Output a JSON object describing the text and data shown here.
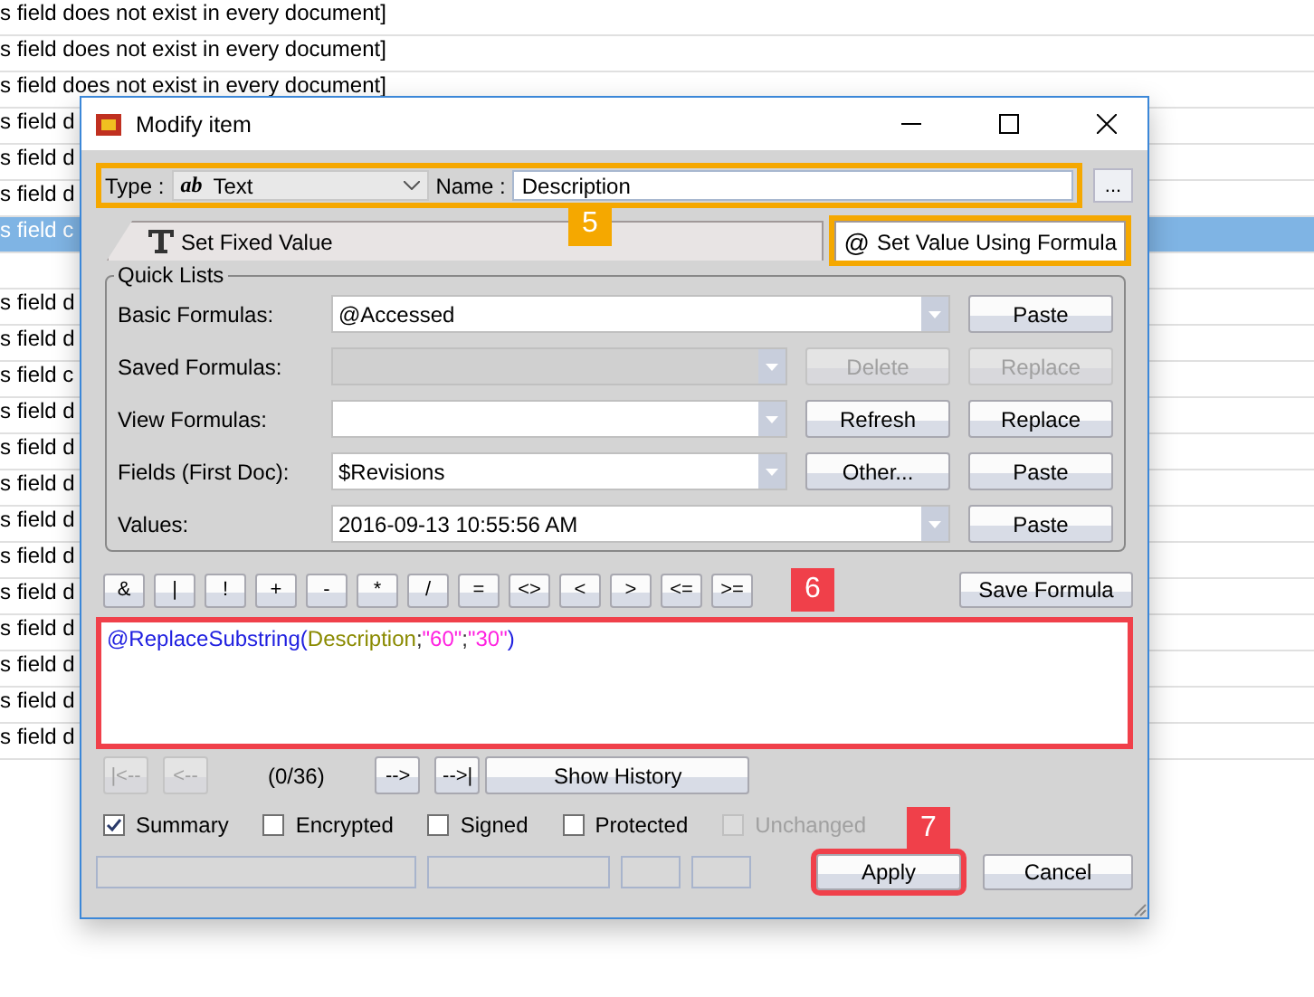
{
  "list": {
    "rows": [
      {
        "text": "s field does not exist in every document]",
        "selected": false
      },
      {
        "text": "s field does not exist in every document]",
        "selected": false
      },
      {
        "text": "s field does not exist in every document]",
        "selected": false
      },
      {
        "text": "s field d",
        "selected": false
      },
      {
        "text": "s field d",
        "selected": false
      },
      {
        "text": "s field d",
        "selected": false
      },
      {
        "text": "s field c",
        "selected": true
      },
      {
        "selected": false
      },
      {
        "text": "s field d",
        "selected": false
      },
      {
        "text": "s field d",
        "selected": false
      },
      {
        "text": "s field c",
        "selected": false
      },
      {
        "text": "s field d",
        "selected": false
      },
      {
        "text": "s field d",
        "selected": false
      },
      {
        "text": "s field d",
        "selected": false
      },
      {
        "text": "s field d",
        "selected": false
      },
      {
        "text": "s field d",
        "selected": false
      },
      {
        "text": "s field d",
        "selected": false
      },
      {
        "text": "s field d",
        "selected": false
      },
      {
        "text": "s field d",
        "selected": false
      },
      {
        "text": "s field d",
        "selected": false
      },
      {
        "text": "s field d",
        "selected": false
      }
    ]
  },
  "dialog": {
    "title": "Modify item",
    "type_label": "Type :",
    "type_value": "Text",
    "type_glyph": "ab",
    "name_label": "Name :",
    "name_value": "Description",
    "browse_button": "...",
    "tabs": [
      {
        "label": "Set Fixed Value",
        "selected": false
      },
      {
        "glyph": "@",
        "label": "Set Value Using Formula",
        "selected": true
      }
    ],
    "quick_lists": {
      "title": "Quick Lists",
      "rows": [
        {
          "label": "Basic Formulas:",
          "value": "@Accessed",
          "disabled": false,
          "buttons": [
            {
              "label": "Paste",
              "disabled": false
            }
          ]
        },
        {
          "label": "Saved Formulas:",
          "disabled": true,
          "buttons": [
            {
              "label": "Delete",
              "disabled": true
            },
            {
              "label": "Replace",
              "disabled": true
            }
          ]
        },
        {
          "label": "View Formulas:",
          "disabled": false,
          "buttons": [
            {
              "label": "Refresh",
              "disabled": false
            },
            {
              "label": "Replace",
              "disabled": false
            }
          ]
        },
        {
          "label": "Fields (First Doc):",
          "value": "$Revisions",
          "disabled": false,
          "buttons": [
            {
              "label": "Other...",
              "disabled": false
            },
            {
              "label": "Paste",
              "disabled": false
            }
          ]
        },
        {
          "label": "Values:",
          "value": "2016-09-13 10:55:56 AM",
          "disabled": false,
          "buttons": [
            {
              "label": "Paste",
              "disabled": false
            }
          ]
        }
      ]
    },
    "operators": [
      "&",
      "|",
      "!",
      "+",
      "-",
      "*",
      "/",
      "=",
      "<>",
      "<",
      ">",
      "<=",
      ">="
    ],
    "save_button": "Save Formula",
    "formula": [
      {
        "kind": "function",
        "text": "@ReplaceSubstring("
      },
      {
        "kind": "field",
        "text": "Description"
      },
      {
        "kind": "punct",
        "text": ";"
      },
      {
        "kind": "string",
        "text": "\"60\""
      },
      {
        "kind": "punct",
        "text": ";"
      },
      {
        "kind": "string",
        "text": "\"30\""
      },
      {
        "kind": "function",
        "text": ")"
      }
    ],
    "history": {
      "back": [
        {
          "label": "|<--",
          "disabled": true
        },
        {
          "label": "<--",
          "disabled": true
        }
      ],
      "counter": "(0/36)",
      "forward": [
        {
          "label": "-->",
          "disabled": false
        },
        {
          "label": "-->|",
          "disabled": false
        }
      ],
      "show_button": "Show History"
    },
    "options": [
      {
        "label": "Summary",
        "checked": true,
        "disabled": false
      },
      {
        "label": "Encrypted",
        "checked": false,
        "disabled": false
      },
      {
        "label": "Signed",
        "checked": false,
        "disabled": false
      },
      {
        "label": "Protected",
        "checked": false,
        "disabled": false
      },
      {
        "label": "Unchanged",
        "checked": false,
        "disabled": true
      }
    ],
    "apply_button": "Apply",
    "cancel_button": "Cancel"
  },
  "callouts": [
    {
      "label": "5",
      "color": "#f5a800"
    },
    {
      "label": "6",
      "color": "#f0404a"
    },
    {
      "label": "7",
      "color": "#f0404a"
    }
  ]
}
